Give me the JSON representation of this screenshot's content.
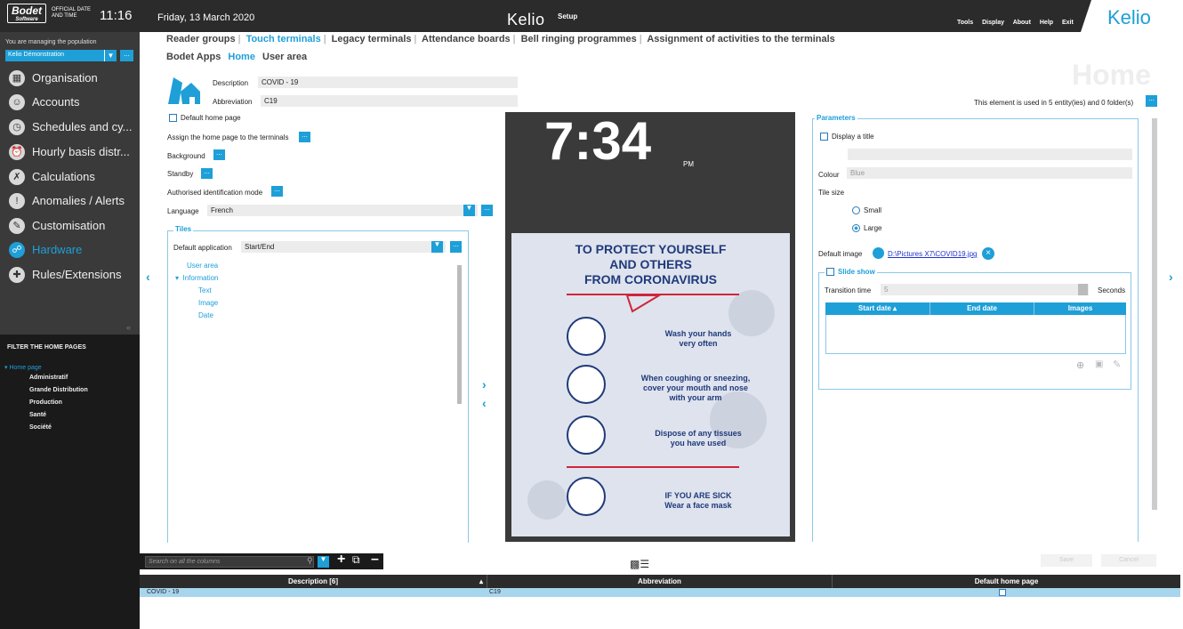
{
  "topbar": {
    "brand": "Bodet",
    "brand_sub": "Software",
    "official": "OFFICIAL DATE AND TIME",
    "time": "11:16",
    "date": "Friday, 13 March 2020",
    "kelio_center": "Kelio",
    "setup": "Setup",
    "menu": [
      "Tools",
      "Display",
      "About",
      "Help",
      "Exit"
    ],
    "kelio_right": "Kelio"
  },
  "sidebar": {
    "managing_text": "You are managing the population",
    "population": "Kelio Démonstration",
    "items": [
      {
        "label": "Organisation",
        "icon": "building-icon"
      },
      {
        "label": "Accounts",
        "icon": "accounts-icon"
      },
      {
        "label": "Schedules and cy...",
        "icon": "schedules-icon"
      },
      {
        "label": "Hourly basis distr...",
        "icon": "hourly-icon"
      },
      {
        "label": "Calculations",
        "icon": "calculations-icon"
      },
      {
        "label": "Anomalies / Alerts",
        "icon": "alert-icon"
      },
      {
        "label": "Customisation",
        "icon": "customisation-icon"
      },
      {
        "label": "Hardware",
        "icon": "hardware-icon",
        "active": true
      },
      {
        "label": "Rules/Extensions",
        "icon": "rules-icon"
      }
    ]
  },
  "filter": {
    "title": "FILTER THE HOME PAGES",
    "root": "Home page",
    "items": [
      "Administratif",
      "Grande Distribution",
      "Production",
      "Santé",
      "Société"
    ]
  },
  "tabs1": [
    "Reader groups",
    "Touch terminals",
    "Legacy terminals",
    "Attendance boards",
    "Bell ringing programmes",
    "Assignment of activities to the terminals"
  ],
  "tabs2": [
    "Bodet Apps",
    "Home",
    "User area"
  ],
  "watermark": "Home",
  "form": {
    "description_label": "Description",
    "description": "COVID - 19",
    "abbreviation_label": "Abbreviation",
    "abbreviation": "C19",
    "default_home_page": "Default home page",
    "assign": "Assign the home page to the terminals",
    "background": "Background",
    "standby": "Standby",
    "auth_mode": "Authorised identification mode",
    "language_label": "Language",
    "language": "French",
    "tiles_legend": "Tiles",
    "default_app_label": "Default application",
    "default_app": "Start/End",
    "tree": {
      "user_area": "User area",
      "information": "Information",
      "text": "Text",
      "image": "Image",
      "date": "Date"
    }
  },
  "preview": {
    "clock": "7:34",
    "ampm": "PM",
    "poster_title": [
      "TO PROTECT YOURSELF",
      "AND OTHERS",
      "FROM CORONAVIRUS"
    ],
    "tips": [
      [
        "Wash your hands",
        "very often"
      ],
      [
        "When coughing or sneezing,",
        "cover your mouth and nose",
        "with your arm"
      ],
      [
        "Dispose of any tissues",
        "you have used"
      ],
      [
        "IF YOU ARE SICK",
        "Wear a face mask"
      ]
    ]
  },
  "params": {
    "used_text": "This element is used in 5 entity(ies) and 0 folder(s)",
    "legend": "Parameters",
    "display_title": "Display a title",
    "colour_label": "Colour",
    "colour": "Blue",
    "tile_size": "Tile size",
    "small": "Small",
    "large": "Large",
    "default_image_label": "Default image",
    "default_image": "D:\\Pictures X7\\COVID19.jpg",
    "slide_show": "Slide show",
    "transition_label": "Transition time",
    "transition": "5",
    "seconds": "Seconds",
    "grid_cols": [
      "Start date",
      "End date",
      "Images"
    ]
  },
  "bottom": {
    "search_placeholder": "Search on all the columns",
    "save": "Save",
    "cancel": "Cancel",
    "cols": [
      "Description [6]",
      "Abbreviation",
      "Default home page"
    ],
    "row": {
      "description": "COVID - 19",
      "abbreviation": "C19"
    }
  }
}
